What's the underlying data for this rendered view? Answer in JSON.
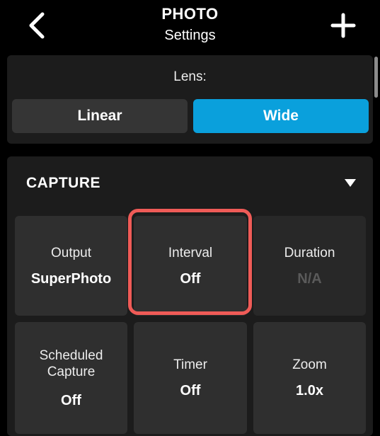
{
  "header": {
    "title": "PHOTO",
    "subtitle": "Settings",
    "back_icon": "chevron-left-icon",
    "add_icon": "plus-icon"
  },
  "lens": {
    "label": "Lens:",
    "options": [
      {
        "label": "Linear",
        "selected": false
      },
      {
        "label": "Wide",
        "selected": true
      }
    ],
    "accent_color": "#0aa0dc"
  },
  "capture": {
    "title": "CAPTURE",
    "caret_icon": "caret-down-icon",
    "tiles": [
      {
        "label": "Output",
        "value": "SuperPhoto",
        "enabled": true
      },
      {
        "label": "Interval",
        "value": "Off",
        "enabled": true,
        "highlighted": true
      },
      {
        "label": "Duration",
        "value": "N/A",
        "enabled": false
      },
      {
        "label": "Scheduled\nCapture",
        "value": "Off",
        "enabled": true
      },
      {
        "label": "Timer",
        "value": "Off",
        "enabled": true
      },
      {
        "label": "Zoom",
        "value": "1.0x",
        "enabled": true
      }
    ],
    "highlight_color": "#ef5b57"
  }
}
